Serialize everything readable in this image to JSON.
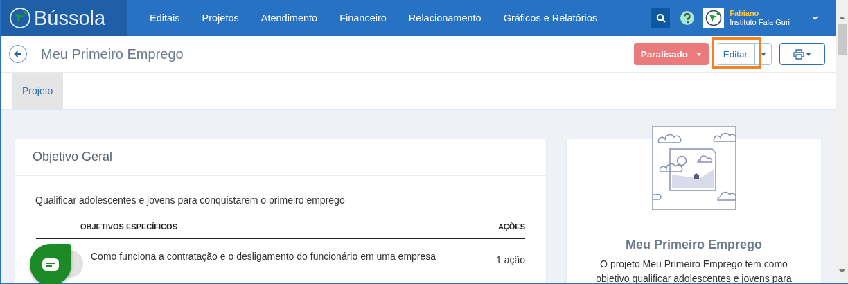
{
  "logo": {
    "text": "Bússola"
  },
  "nav": [
    "Editais",
    "Projetos",
    "Atendimento",
    "Financeiro",
    "Relacionamento",
    "Gráficos e Relatórios"
  ],
  "user": {
    "name": "Fabiano",
    "organization": "Instituto Fala Guri"
  },
  "page_title": "Meu Primeiro Emprego",
  "status_button": "Paralisado",
  "edit_button": {
    "label": "Editar",
    "highlighted": true
  },
  "tabs": [
    {
      "label": "Projeto",
      "selected": true
    }
  ],
  "objective": {
    "title": "Objetivo Geral",
    "text": "Qualificar adolescentes e jovens para conquistarem o primeiro emprego",
    "table": {
      "columns": [
        "OBJETIVOS ESPECÍFICOS",
        "AÇÕES"
      ],
      "rows": [
        {
          "objective": "Como funciona a contratação e o desligamento do funcionário em uma empresa",
          "actions": "1 ação"
        }
      ]
    }
  },
  "summary": {
    "title": "Meu Primeiro Emprego",
    "description": "O projeto Meu Primeiro Emprego tem como objetivo qualificar adolescentes e jovens para"
  }
}
